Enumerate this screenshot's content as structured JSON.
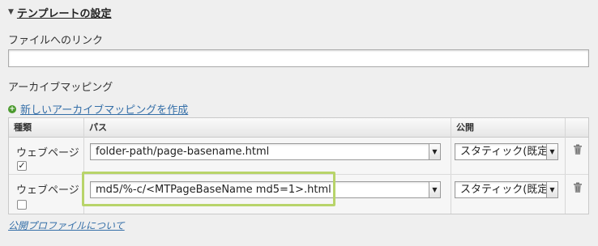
{
  "section": {
    "title": "テンプレートの設定"
  },
  "file_link": {
    "label": "ファイルへのリンク",
    "value": ""
  },
  "archive_mapping": {
    "label": "アーカイブマッピング",
    "new_link": "新しいアーカイブマッピングを作成",
    "columns": {
      "type": "種類",
      "path": "パス",
      "publish": "公開"
    },
    "rows": [
      {
        "type": "ウェブページ",
        "checked": true,
        "path": "folder-path/page-basename.html",
        "publish": "スタティック(既定)"
      },
      {
        "type": "ウェブページ",
        "checked": false,
        "path": "md5/%-c/<MTPageBaseName md5=1>.html",
        "publish": "スタティック(既定)"
      }
    ]
  },
  "profile_link": "公開プロファイルについて",
  "colors": {
    "link": "#356fa8",
    "highlight": "#b8d46a",
    "add_icon": "#4b9a2e"
  },
  "icons": [
    "disclosure-triangle-icon",
    "add-icon",
    "select-arrow-icon",
    "trash-icon"
  ]
}
